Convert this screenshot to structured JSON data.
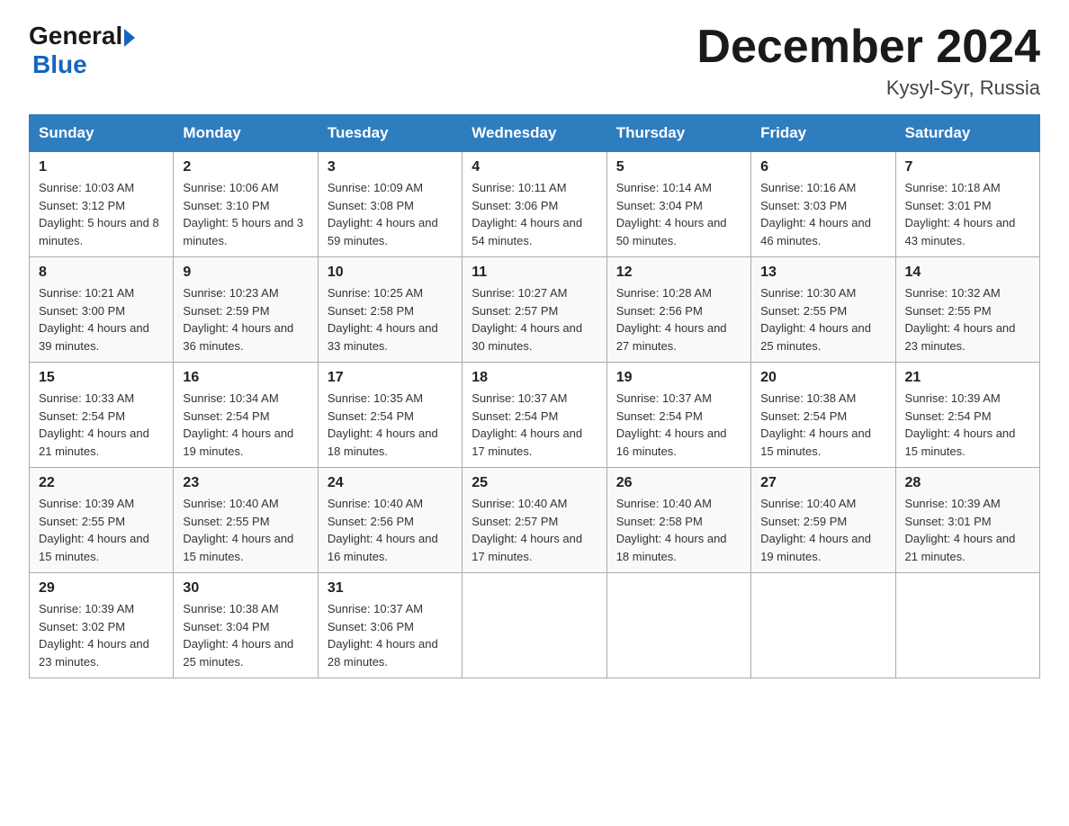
{
  "header": {
    "logo_general": "General",
    "logo_blue": "Blue",
    "month_title": "December 2024",
    "location": "Kysyl-Syr, Russia"
  },
  "days_of_week": [
    "Sunday",
    "Monday",
    "Tuesday",
    "Wednesday",
    "Thursday",
    "Friday",
    "Saturday"
  ],
  "weeks": [
    [
      {
        "day": "1",
        "sunrise": "10:03 AM",
        "sunset": "3:12 PM",
        "daylight": "5 hours and 8 minutes."
      },
      {
        "day": "2",
        "sunrise": "10:06 AM",
        "sunset": "3:10 PM",
        "daylight": "5 hours and 3 minutes."
      },
      {
        "day": "3",
        "sunrise": "10:09 AM",
        "sunset": "3:08 PM",
        "daylight": "4 hours and 59 minutes."
      },
      {
        "day": "4",
        "sunrise": "10:11 AM",
        "sunset": "3:06 PM",
        "daylight": "4 hours and 54 minutes."
      },
      {
        "day": "5",
        "sunrise": "10:14 AM",
        "sunset": "3:04 PM",
        "daylight": "4 hours and 50 minutes."
      },
      {
        "day": "6",
        "sunrise": "10:16 AM",
        "sunset": "3:03 PM",
        "daylight": "4 hours and 46 minutes."
      },
      {
        "day": "7",
        "sunrise": "10:18 AM",
        "sunset": "3:01 PM",
        "daylight": "4 hours and 43 minutes."
      }
    ],
    [
      {
        "day": "8",
        "sunrise": "10:21 AM",
        "sunset": "3:00 PM",
        "daylight": "4 hours and 39 minutes."
      },
      {
        "day": "9",
        "sunrise": "10:23 AM",
        "sunset": "2:59 PM",
        "daylight": "4 hours and 36 minutes."
      },
      {
        "day": "10",
        "sunrise": "10:25 AM",
        "sunset": "2:58 PM",
        "daylight": "4 hours and 33 minutes."
      },
      {
        "day": "11",
        "sunrise": "10:27 AM",
        "sunset": "2:57 PM",
        "daylight": "4 hours and 30 minutes."
      },
      {
        "day": "12",
        "sunrise": "10:28 AM",
        "sunset": "2:56 PM",
        "daylight": "4 hours and 27 minutes."
      },
      {
        "day": "13",
        "sunrise": "10:30 AM",
        "sunset": "2:55 PM",
        "daylight": "4 hours and 25 minutes."
      },
      {
        "day": "14",
        "sunrise": "10:32 AM",
        "sunset": "2:55 PM",
        "daylight": "4 hours and 23 minutes."
      }
    ],
    [
      {
        "day": "15",
        "sunrise": "10:33 AM",
        "sunset": "2:54 PM",
        "daylight": "4 hours and 21 minutes."
      },
      {
        "day": "16",
        "sunrise": "10:34 AM",
        "sunset": "2:54 PM",
        "daylight": "4 hours and 19 minutes."
      },
      {
        "day": "17",
        "sunrise": "10:35 AM",
        "sunset": "2:54 PM",
        "daylight": "4 hours and 18 minutes."
      },
      {
        "day": "18",
        "sunrise": "10:37 AM",
        "sunset": "2:54 PM",
        "daylight": "4 hours and 17 minutes."
      },
      {
        "day": "19",
        "sunrise": "10:37 AM",
        "sunset": "2:54 PM",
        "daylight": "4 hours and 16 minutes."
      },
      {
        "day": "20",
        "sunrise": "10:38 AM",
        "sunset": "2:54 PM",
        "daylight": "4 hours and 15 minutes."
      },
      {
        "day": "21",
        "sunrise": "10:39 AM",
        "sunset": "2:54 PM",
        "daylight": "4 hours and 15 minutes."
      }
    ],
    [
      {
        "day": "22",
        "sunrise": "10:39 AM",
        "sunset": "2:55 PM",
        "daylight": "4 hours and 15 minutes."
      },
      {
        "day": "23",
        "sunrise": "10:40 AM",
        "sunset": "2:55 PM",
        "daylight": "4 hours and 15 minutes."
      },
      {
        "day": "24",
        "sunrise": "10:40 AM",
        "sunset": "2:56 PM",
        "daylight": "4 hours and 16 minutes."
      },
      {
        "day": "25",
        "sunrise": "10:40 AM",
        "sunset": "2:57 PM",
        "daylight": "4 hours and 17 minutes."
      },
      {
        "day": "26",
        "sunrise": "10:40 AM",
        "sunset": "2:58 PM",
        "daylight": "4 hours and 18 minutes."
      },
      {
        "day": "27",
        "sunrise": "10:40 AM",
        "sunset": "2:59 PM",
        "daylight": "4 hours and 19 minutes."
      },
      {
        "day": "28",
        "sunrise": "10:39 AM",
        "sunset": "3:01 PM",
        "daylight": "4 hours and 21 minutes."
      }
    ],
    [
      {
        "day": "29",
        "sunrise": "10:39 AM",
        "sunset": "3:02 PM",
        "daylight": "4 hours and 23 minutes."
      },
      {
        "day": "30",
        "sunrise": "10:38 AM",
        "sunset": "3:04 PM",
        "daylight": "4 hours and 25 minutes."
      },
      {
        "day": "31",
        "sunrise": "10:37 AM",
        "sunset": "3:06 PM",
        "daylight": "4 hours and 28 minutes."
      },
      null,
      null,
      null,
      null
    ]
  ]
}
